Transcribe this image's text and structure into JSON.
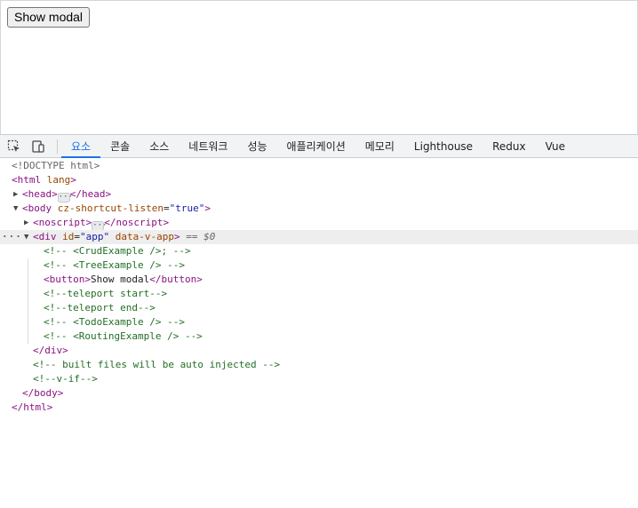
{
  "page": {
    "show_modal_button": "Show modal"
  },
  "devtools": {
    "tabs": [
      "요소",
      "콘솔",
      "소스",
      "네트워크",
      "성능",
      "애플리케이션",
      "메모리",
      "Lighthouse",
      "Redux",
      "Vue"
    ],
    "active_tab": "요소",
    "icons": [
      "inspect-element-icon",
      "device-toolbar-icon"
    ],
    "dom": {
      "doctype": "<!DOCTYPE html>",
      "html_open_tag": "html",
      "html_attr": "lang",
      "head_tag": "head",
      "head_close": "</head>",
      "body_tag": "body",
      "body_attr_name": "cz-shortcut-listen",
      "body_attr_value": "\"true\"",
      "noscript_tag": "noscript",
      "noscript_close": "</noscript>",
      "div_tag": "div",
      "div_id_attr": "id",
      "div_id_value": "\"app\"",
      "div_data_attr": "data-v-app",
      "selected_suffix": "== $0",
      "comment_crud": "<!-- <CrudExample />; -->",
      "comment_tree": "<!-- <TreeExample /> -->",
      "button_open": "<button>",
      "button_text": "Show modal",
      "button_close": "</button>",
      "comment_teleport_start": "<!--teleport start-->",
      "comment_teleport_end": "<!--teleport end-->",
      "comment_todo": "<!-- <TodoExample /> -->",
      "comment_routing": "<!-- <RoutingExample /> -->",
      "div_close": "</div>",
      "comment_built": "<!-- built files will be auto injected -->",
      "comment_vif": "<!--v-if-->",
      "body_close": "</body>",
      "html_close": "</html>",
      "ellipsis": "···",
      "row_dots": "···"
    }
  }
}
